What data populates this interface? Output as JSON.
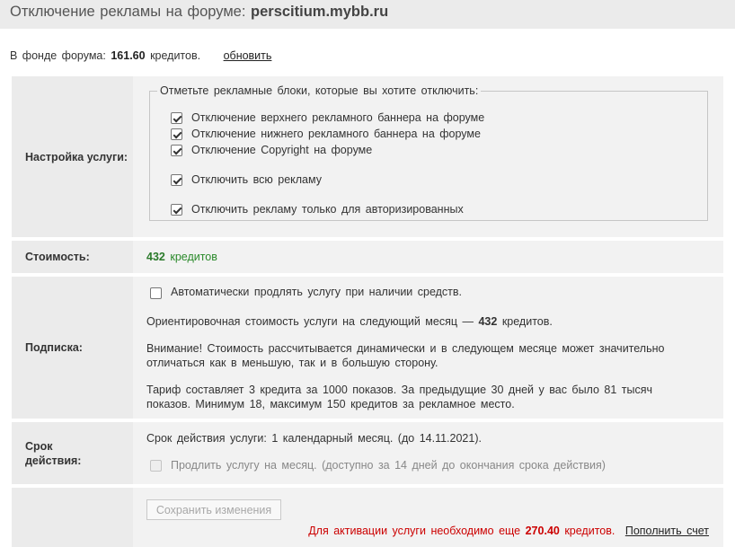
{
  "header": {
    "title_prefix": "Отключение рекламы на форуме:",
    "forum_domain": "perscitium.mybb.ru"
  },
  "fund": {
    "prefix": "В фонде форума:",
    "amount": "161.60",
    "unit": "кредитов.",
    "refresh_link": "обновить"
  },
  "settings": {
    "label": "Настройка услуги:",
    "legend": "Отметьте рекламные блоки, которые вы хотите отключить:",
    "options": [
      {
        "label": "Отключение верхнего рекламного баннера на форуме",
        "checked": true
      },
      {
        "label": "Отключение нижнего рекламного баннера на форуме",
        "checked": true
      },
      {
        "label": "Отключение Copyright на форуме",
        "checked": true
      },
      {
        "label": "Отключить всю рекламу",
        "checked": true
      },
      {
        "label": "Отключить рекламу только для авторизированных",
        "checked": true
      }
    ]
  },
  "cost": {
    "label": "Стоимость:",
    "amount": "432",
    "unit": "кредитов"
  },
  "subscription": {
    "label": "Подписка:",
    "auto_renew_label": "Автоматически продлять услугу при наличии средств.",
    "auto_renew_checked": false,
    "estimate_prefix": "Ориентировочная стоимость услуги на следующий месяц —",
    "estimate_amount": "432",
    "estimate_unit": "кредитов.",
    "warning": "Внимание! Стоимость рассчитывается динамически и в следующем месяце может значительно отличаться как в меньшую, так и в большую сторону.",
    "tariff": "Тариф составляет 3 кредита за 1000 показов. За предыдущие 30 дней у вас было 81 тысяч показов. Минимум 18, максимум 150 кредитов за рекламное место."
  },
  "term": {
    "label": "Срок действия:",
    "text": "Срок действия услуги: 1 календарный месяц. (до 14.11.2021).",
    "extend_label": "Продлить услугу на месяц. (доступно за 14 дней до окончания срока действия)"
  },
  "actions": {
    "save_button": "Сохранить изменения",
    "activation_prefix": "Для активации услуги необходимо еще",
    "activation_amount": "270.40",
    "activation_unit": "кредитов.",
    "topup_link": "Пополнить счет"
  },
  "colors": {
    "background": "#ebebeb",
    "cell": "#f2f2f2",
    "cost_green": "#2b8a2b",
    "alert_red": "#cc0000"
  }
}
